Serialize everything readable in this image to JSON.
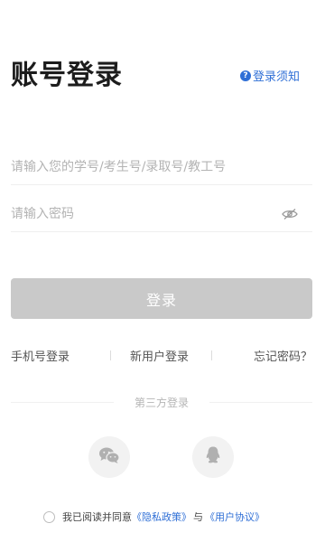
{
  "page": {
    "title": "账号登录",
    "notice_link": "登录须知"
  },
  "form": {
    "account_placeholder": "请输入您的学号/考生号/录取号/教工号",
    "account_value": "",
    "password_placeholder": "请输入密码",
    "password_value": "",
    "login_button": "登录"
  },
  "links": {
    "phone_login": "手机号登录",
    "new_user": "新用户登录",
    "forgot_password": "忘记密码？"
  },
  "third_party": {
    "label": "第三方登录",
    "providers": [
      "wechat-icon",
      "qq-icon"
    ]
  },
  "agreement": {
    "checked": false,
    "prefix": "我已阅读并同意",
    "privacy_link": "《隐私政策》",
    "conjunction": "与",
    "user_agreement_link": "《用户协议》"
  },
  "colors": {
    "accent": "#2f6fd6",
    "button_disabled": "#c9c9c9",
    "placeholder": "#b3b3b3"
  },
  "icons": {
    "notice": "help-circle-icon",
    "password_toggle": "eye-closed-icon",
    "social": [
      "wechat-icon",
      "qq-icon"
    ]
  }
}
